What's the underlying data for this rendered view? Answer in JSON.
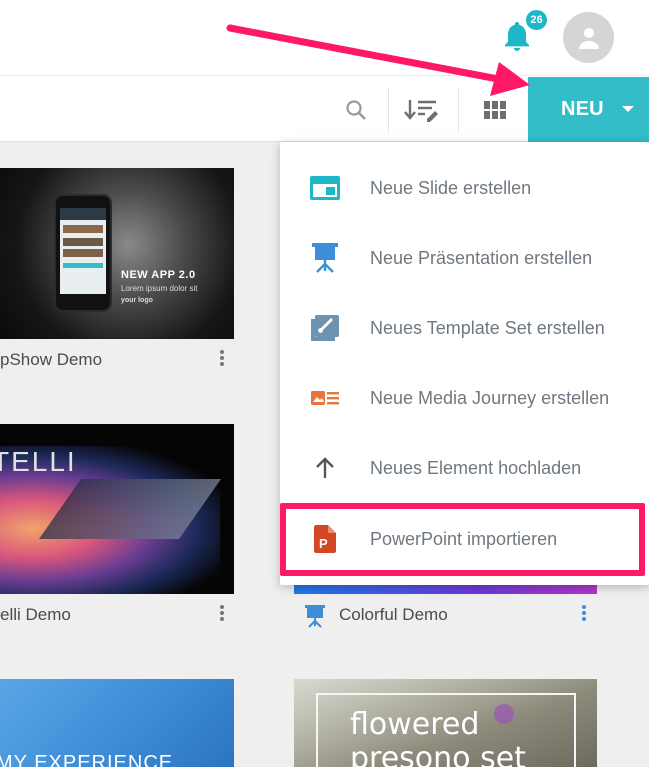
{
  "header": {
    "notifications_count": "26",
    "bell_icon": "bell-icon",
    "avatar_icon": "user-icon"
  },
  "toolbar": {
    "search_icon": "search-icon",
    "sort_icon": "sort-edit-icon",
    "grid_icon": "grid-view-icon",
    "new_label": "NEU",
    "accent_color": "#33bdc9"
  },
  "menu": {
    "items": [
      {
        "label": "Neue Slide erstellen",
        "icon": "slide-icon",
        "color": "#1fb7c7"
      },
      {
        "label": "Neue Präsentation erstellen",
        "icon": "presentation-icon",
        "color": "#3c8fd6"
      },
      {
        "label": "Neues Template Set erstellen",
        "icon": "template-brush-icon",
        "color": "#6e93b0"
      },
      {
        "label": "Neue Media Journey erstellen",
        "icon": "media-journey-icon",
        "color": "#e8743f"
      },
      {
        "label": "Neues Element hochladen",
        "icon": "upload-arrow-icon",
        "color": "#555555"
      },
      {
        "label": "PowerPoint importieren",
        "icon": "powerpoint-icon",
        "color": "#d24726"
      }
    ]
  },
  "cards": [
    {
      "title": "pShow Demo",
      "thumb_text": "NEW APP 2.0",
      "thumb_sub": "Lorem ipsum dolor sit",
      "thumb_logo": "your logo"
    },
    {
      "title": "elli Demo",
      "thumb_text": "TELLI"
    },
    {
      "title": "Colorful Demo"
    },
    {
      "title": "",
      "thumb_text": "MY EXPERIENCE"
    },
    {
      "title": "",
      "thumb_text": "flowered",
      "thumb_text2": "presono set"
    }
  ],
  "annotation": {
    "arrow_color": "#ff1867",
    "highlight_color": "#ff1867"
  }
}
